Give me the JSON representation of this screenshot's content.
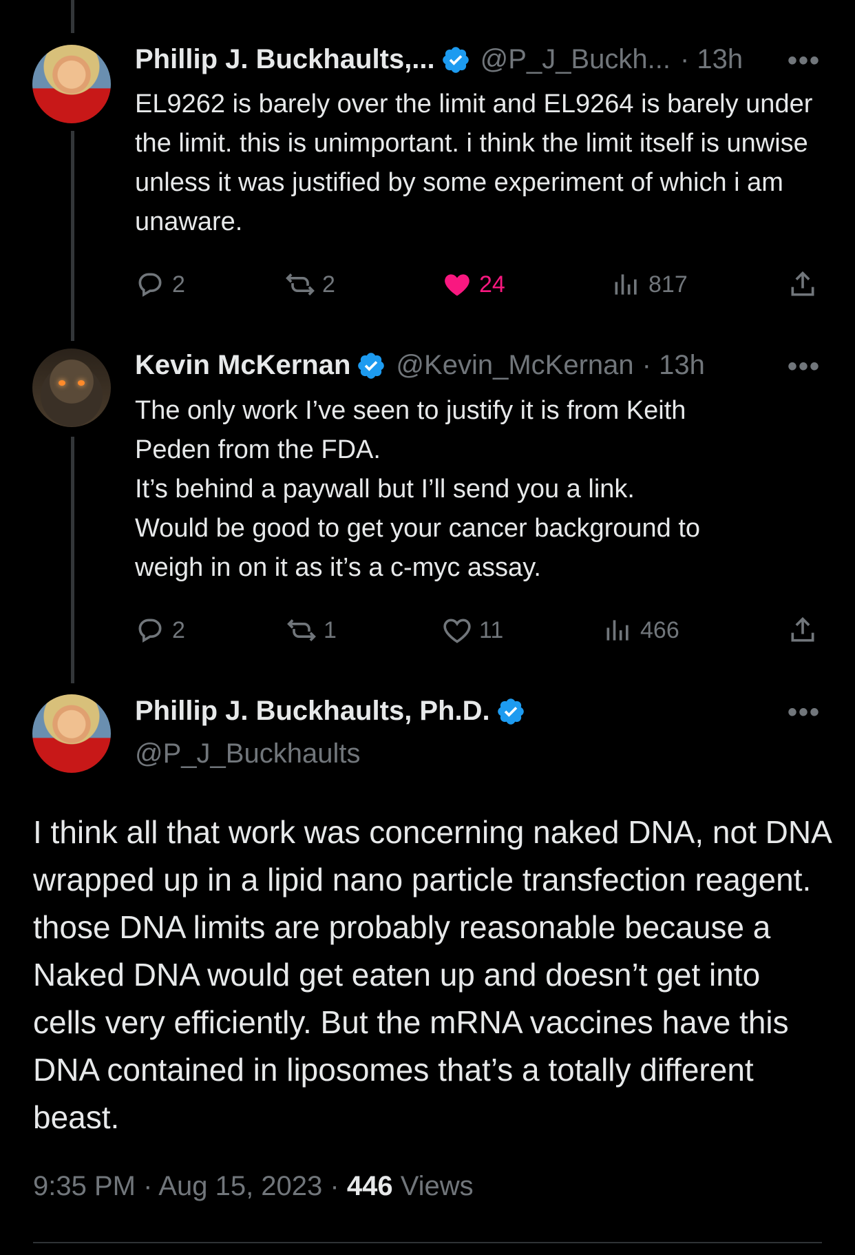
{
  "tweet1": {
    "name": "Phillip J. Buckhaults,...",
    "handle": "@P_J_Buckh...",
    "time": "· 13h",
    "text": "EL9262 is barely over the limit and EL9264 is barely under the limit.   this is unimportant.  i think the limit itself is unwise unless it was justified by some experiment of which i am unaware.",
    "replies": "2",
    "reposts": "2",
    "likes": "24",
    "views": "817"
  },
  "tweet2": {
    "name": "Kevin McKernan",
    "handle": "@Kevin_McKernan",
    "time": "· 13h",
    "text_lines": [
      "The only work I’ve seen to justify it is from Keith",
      "Peden from the FDA.",
      "It’s behind a paywall but I’ll send you a link.",
      "Would be good to get your cancer background to",
      "weigh in on it as it’s a c-myc assay."
    ],
    "replies": "2",
    "reposts": "1",
    "likes": "11",
    "views": "466"
  },
  "main_tweet": {
    "name": "Phillip J. Buckhaults, Ph.D.",
    "handle": "@P_J_Buckhaults",
    "text": "I think all that work was concerning naked DNA, not DNA wrapped up in a lipid nano particle transfection reagent.  those DNA limits are probably reasonable because a Naked DNA would get eaten up and doesn’t get into cells very efficiently. But the mRNA vaccines have this DNA contained in liposomes that’s a totally different beast.",
    "time": "9:35 PM · Aug 15, 2023 · ",
    "views_count": "446",
    "views_label": " Views"
  },
  "ui": {
    "more": "•••",
    "accent_like": "#f91880",
    "accent_verified": "#1d9bf0"
  }
}
